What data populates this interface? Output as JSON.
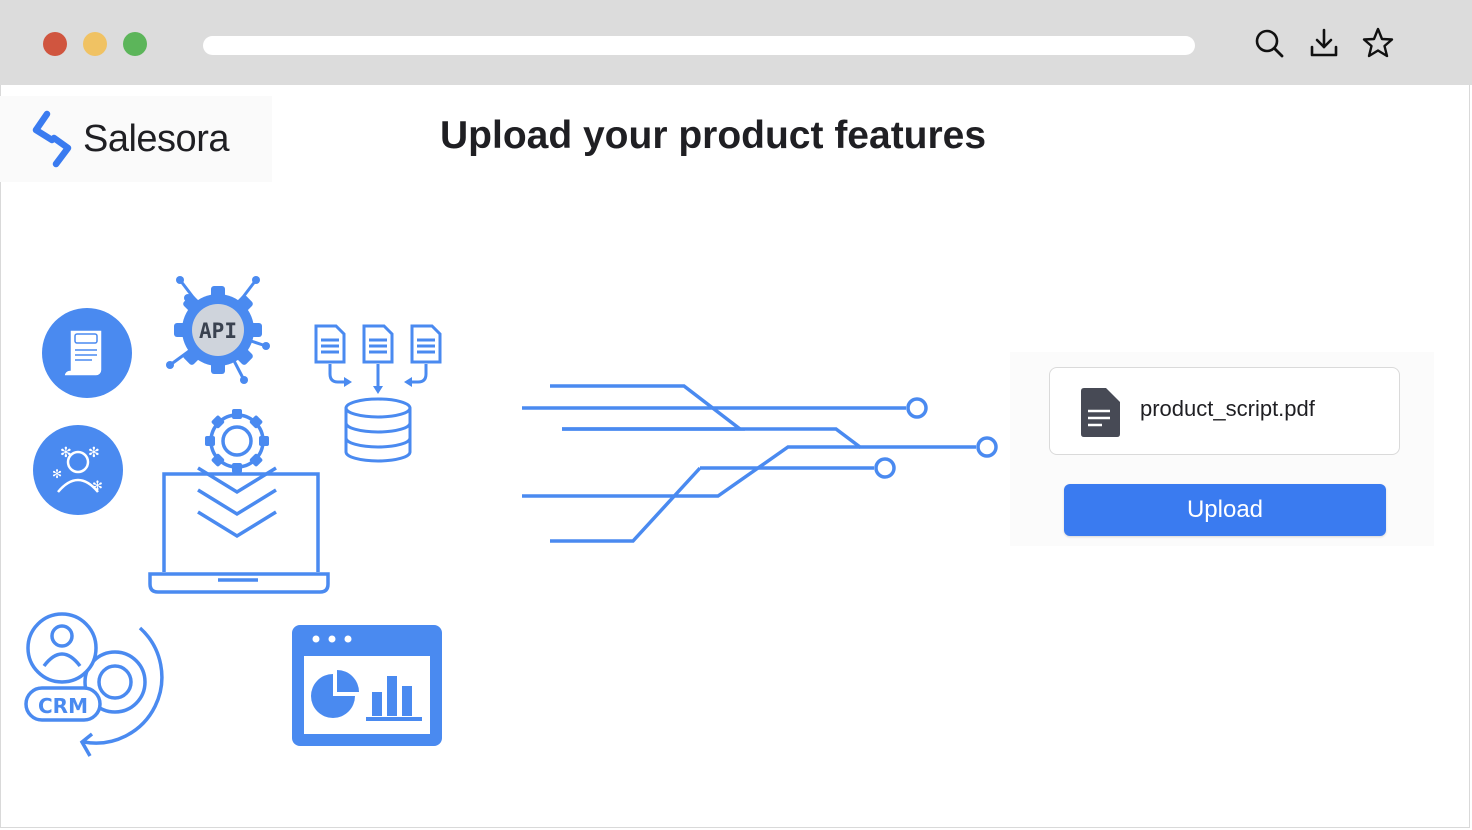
{
  "browser": {
    "traffic_lights": [
      "#d0553f",
      "#f0c263",
      "#5cb55a"
    ],
    "toolbar_icons": [
      "search-icon",
      "download-icon",
      "star-icon"
    ]
  },
  "brand": {
    "name": "Salesora",
    "accent": "#3a7bf0"
  },
  "page": {
    "title": "Upload your product features"
  },
  "illustration": {
    "icon_color": "#4a8af0",
    "labels": {
      "api": "API",
      "crm": "CRM"
    },
    "icons": [
      "script-icon",
      "api-gear-icon",
      "documents-to-database-icon",
      "support-agent-icon",
      "laptop-layers-icon",
      "crm-icon",
      "analytics-dashboard-icon",
      "data-flow-lines"
    ]
  },
  "upload": {
    "file_name": "product_script.pdf",
    "file_icon": "document-icon",
    "button_label": "Upload"
  }
}
